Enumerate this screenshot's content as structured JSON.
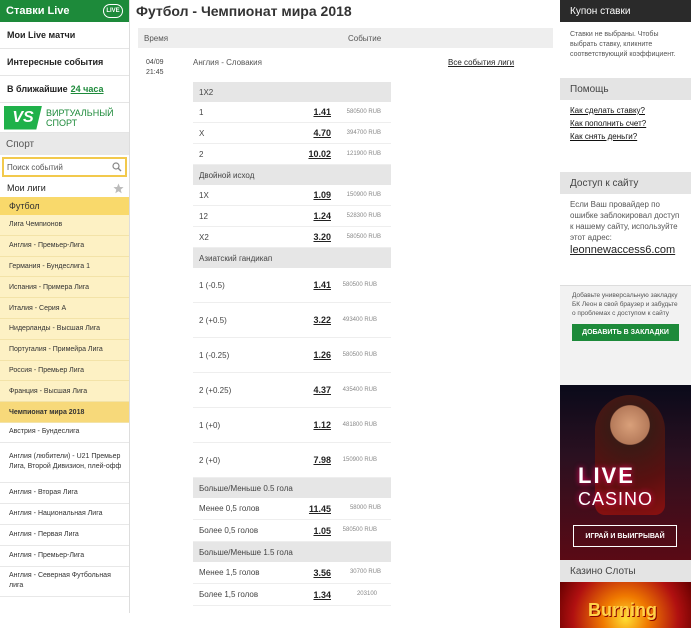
{
  "left": {
    "live_title": "Ставки Live",
    "live_badge": "LIVE",
    "my_live": "Мои Live матчи",
    "interesting": "Интересные события",
    "soon_prefix": "В ближайшие",
    "soon_link": "24 часа",
    "vs": "VS",
    "virtual_line1": "ВИРТУАЛЬНЫЙ",
    "virtual_line2": "СПОРТ",
    "sport_head": "Спорт",
    "search_placeholder": "Поиск событий",
    "my_leagues": "Мои лиги",
    "football": "Футбол",
    "leagues": [
      "Лига Чемпионов",
      "Англия - Премьер-Лига",
      "Германия - Бундеслига 1",
      "Испания - Примера Лига",
      "Италия - Серия А",
      "Нидерланды - Высшая Лига",
      "Португалия - Примейра Лига",
      "Россия - Премьер Лига",
      "Франция - Высшая Лига",
      "Чемпионат мира 2018"
    ],
    "leagues2": [
      "Австрия - Бундеслига",
      "Англия (любители) - U21 Премьер Лига, Второй Дивизион, плей-офф",
      "Англия - Вторая Лига",
      "Англия - Национальная Лига",
      "Англия - Первая Лига",
      "Англия - Премьер-Лига",
      "Англия - Северная Футбольная лига"
    ]
  },
  "main": {
    "title": "Футбол - Чемпионат мира 2018",
    "col_time": "Время",
    "col_event": "Событие",
    "event_date": "04/09",
    "event_time": "21:45",
    "event_name": "Англия - Словакия",
    "all_events": "Все события лиги",
    "markets": [
      {
        "name": "1X2",
        "rows": [
          {
            "label": "1",
            "odd": "1.41",
            "sum": "580500 RUB"
          },
          {
            "label": "X",
            "odd": "4.70",
            "sum": "394700 RUB"
          },
          {
            "label": "2",
            "odd": "10.02",
            "sum": "121900 RUB"
          }
        ]
      },
      {
        "name": "Двойной исход",
        "rows": [
          {
            "label": "1X",
            "odd": "1.09",
            "sum": "150900 RUB"
          },
          {
            "label": "12",
            "odd": "1.24",
            "sum": "528300 RUB"
          },
          {
            "label": "X2",
            "odd": "3.20",
            "sum": "580500 RUB"
          }
        ]
      },
      {
        "name": "Азиатский гандикап",
        "rows": [
          {
            "label": "1 (-0.5)",
            "odd": "1.41",
            "sum": "580500 RUB"
          },
          {
            "label": "2 (+0.5)",
            "odd": "3.22",
            "sum": "493400 RUB"
          },
          {
            "label": "1 (-0.25)",
            "odd": "1.26",
            "sum": "580500 RUB"
          },
          {
            "label": "2 (+0.25)",
            "odd": "4.37",
            "sum": "435400 RUB"
          },
          {
            "label": "1 (+0)",
            "odd": "1.12",
            "sum": "481800 RUB"
          },
          {
            "label": "2 (+0)",
            "odd": "7.98",
            "sum": "150900 RUB"
          }
        ]
      },
      {
        "name": "Больше/Меньше 0.5 гола",
        "rows": [
          {
            "label": "Менее 0,5 голов",
            "odd": "11.45",
            "sum": "58000 RUB"
          },
          {
            "label": "Более 0,5 голов",
            "odd": "1.05",
            "sum": "580500 RUB"
          }
        ]
      },
      {
        "name": "Больше/Меньше 1.5 гола",
        "rows": [
          {
            "label": "Менее 1,5 голов",
            "odd": "3.56",
            "sum": "30700 RUB"
          },
          {
            "label": "Более 1,5 голов",
            "odd": "1.34",
            "sum": "203100"
          }
        ]
      }
    ]
  },
  "right": {
    "coupon_title": "Купон ставки",
    "coupon_text": "Ставки не выбраны. Чтобы выбрать ставку, кликните соответствующий коэффициент.",
    "help_title": "Помощь",
    "help_links": [
      "Как сделать ставку?",
      "Как пополнить счет?",
      "Как снять деньги?"
    ],
    "access_title": "Доступ к сайту",
    "access_text": "Если Ваш провайдер по ошибке заблокировал доступ к нашему сайту, используйте этот адрес:",
    "access_link": "leonnewaccess6.com",
    "bookmark_text": "Добавьте универсальную закладку БК Леон в свой браузер и забудьте о проблемах с доступом к сайту",
    "bookmark_btn": "ДОБАВИТЬ В ЗАКЛАДКИ",
    "casino_live": "LIVE",
    "casino_word": "CASINO",
    "casino_btn": "ИГРАЙ И ВЫИГРЫВАЙ",
    "slots_title": "Казино Слоты",
    "slots_banner": "Burning"
  }
}
